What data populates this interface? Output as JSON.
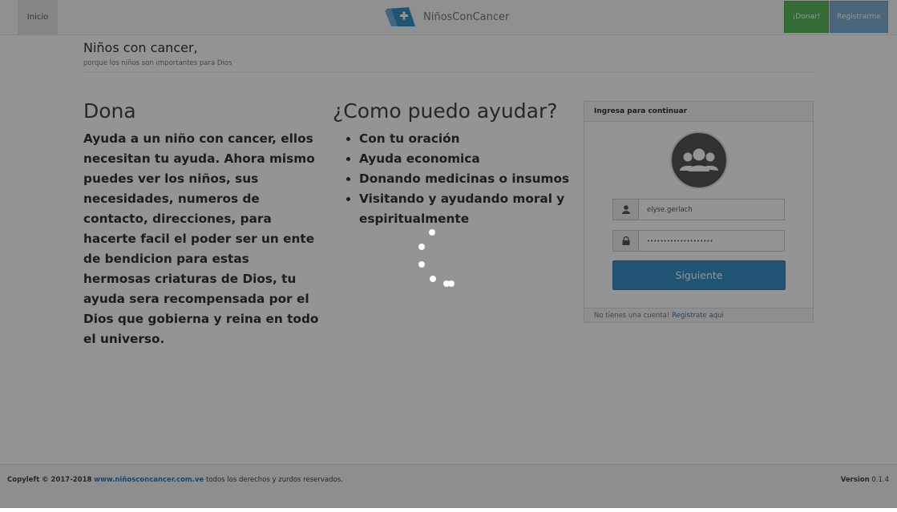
{
  "navbar": {
    "home": "Inicio",
    "brand": "NiñosConCancer",
    "donar": "¡Donar!",
    "registrarme": "Registrarme"
  },
  "hero": {
    "title": "Niños con cancer,",
    "subtitle": "porque los niños son importantes para Dios"
  },
  "dona": {
    "heading": "Dona",
    "text": "Ayuda a un niño con cancer, ellos necesitan tu ayuda. Ahora mismo puedes ver los niños, sus necesidades, numeros de contacto, direcciones, para hacerte facil el poder ser un ente de bendicion para estas hermosas criaturas de Dios, tu ayuda sera recompensada por el Dios que gobierna y reina en todo el universo."
  },
  "ayuda": {
    "heading": "¿Como puedo ayudar?",
    "items": [
      "Con tu oración",
      "Ayuda economica",
      "Donando medicinas o insumos",
      "Visitando y ayudando moral y espiritualmente"
    ]
  },
  "login": {
    "header": "Ingresa para continuar",
    "username": "elyse.gerlach",
    "password": "••••••••••••••••••••",
    "submit": "Siguiente",
    "footer_text": "No tienes una cuenta!",
    "footer_link": "Registrate aqui"
  },
  "footer": {
    "copyleft": "Copyleft © 2017-2018",
    "site": "www.niñosconcancer.com.ve",
    "rights": "todos los derechos y zurdos reservados.",
    "version_label": "Version",
    "version": "0.1.4"
  },
  "icons": {
    "brand": "hospital-flag-icon",
    "user": "user-icon",
    "lock": "lock-icon",
    "avatar": "group-icon"
  },
  "colors": {
    "success": "#5cb85c",
    "primary": "#3a8fc4",
    "link": "#337ab7",
    "overlay": "rgba(0,0,0,0.42)"
  }
}
